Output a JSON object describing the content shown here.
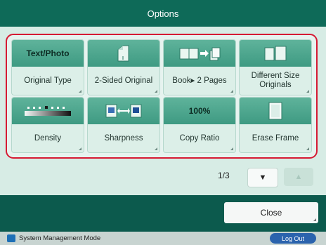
{
  "title": "Options",
  "options": [
    {
      "top_text": "Text/Photo",
      "label": "Original Type"
    },
    {
      "icon": "two-sided-original-icon",
      "label": "2-Sided Original"
    },
    {
      "icon": "book-to-pages-icon",
      "label": "Book▸ 2 Pages"
    },
    {
      "icon": "different-size-originals-icon",
      "label": "Different Size Originals"
    },
    {
      "icon": "density-scale-icon",
      "label": "Density"
    },
    {
      "icon": "sharpness-icon",
      "label": "Sharpness"
    },
    {
      "top_text": "100%",
      "label": "Copy Ratio"
    },
    {
      "icon": "erase-frame-icon",
      "label": "Erase Frame"
    }
  ],
  "pager": {
    "page": "1/3",
    "down_icon": "triangle-down-icon",
    "up_icon": "triangle-up-icon"
  },
  "close_label": "Close",
  "status": {
    "mode_label": "System Management Mode",
    "logout_label": "Log Out"
  },
  "colors": {
    "accent": "#0e6a58",
    "selection_border": "#d61a33",
    "logout": "#2b63ad"
  }
}
